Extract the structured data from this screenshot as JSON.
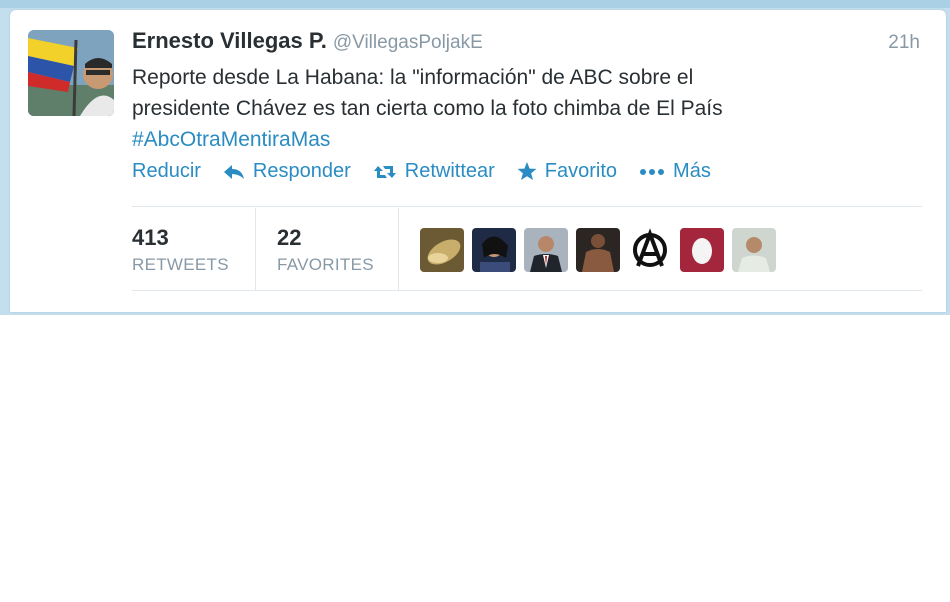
{
  "tweet": {
    "display_name": "Ernesto Villegas P.",
    "handle": "@VillegasPoljakE",
    "time": "21h",
    "text_line1": "Reporte desde La Habana: la \"información\" de ABC sobre el",
    "text_line2": "presidente Chávez es tan cierta como la foto chimba de El País",
    "hashtag": "#AbcOtraMentiraMas"
  },
  "actions": [
    {
      "label": "Reducir",
      "icon": null
    },
    {
      "label": "Responder",
      "icon": "reply-icon"
    },
    {
      "label": "Retwittear",
      "icon": "retweet-icon"
    },
    {
      "label": "Favorito",
      "icon": "star-icon"
    },
    {
      "label": "Más",
      "icon": "more-dots-icon"
    }
  ],
  "stats": {
    "retweets_count": "413",
    "retweets_label": "RETWEETS",
    "favorites_count": "22",
    "favorites_label": "FAVORITES"
  },
  "colors": {
    "link": "#2a8cc2",
    "text": "#292f33",
    "muted": "#8899a6",
    "backdrop": "#c3dfee"
  },
  "favoriter_avatars": [
    "gold-abstract-avatar",
    "woman-portrait-avatar",
    "man-in-suit-avatar",
    "shirtless-man-avatar",
    "anarchy-symbol-avatar",
    "default-egg-avatar",
    "man-portrait-avatar"
  ]
}
